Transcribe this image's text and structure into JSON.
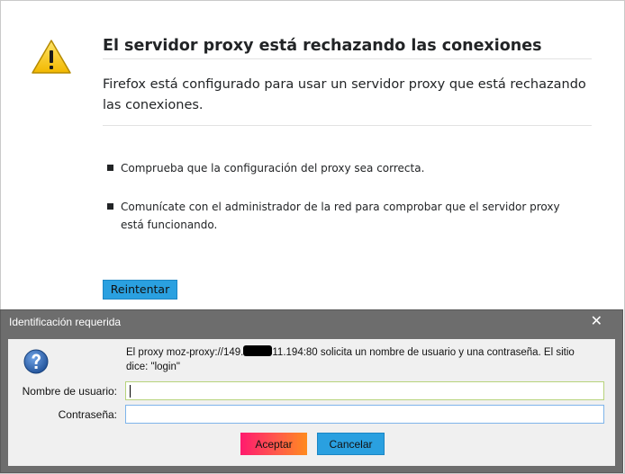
{
  "error_page": {
    "title": "El servidor proxy está rechazando las conexiones",
    "description": "Firefox está configurado para usar un servidor proxy que está rechazando las conexiones.",
    "suggestions": [
      "Comprueba que la configuración del proxy sea correcta.",
      "Comunícate con el administrador de la red para comprobar que el servidor proxy está funcionando."
    ],
    "retry_label": "Reintentar",
    "icon": "warning-icon"
  },
  "auth_dialog": {
    "title": "Identificación requerida",
    "close_glyph": "✕",
    "icon": "question-icon",
    "message_prefix": "El proxy moz-proxy://149.",
    "message_suffix": "11.194:80 solicita un nombre de usuario y una contraseña. El sitio dice: \"login\"",
    "username_label": "Nombre de usuario:",
    "username_value": "",
    "password_label": "Contraseña:",
    "password_value": "",
    "accept_label": "Aceptar",
    "cancel_label": "Cancelar"
  },
  "colors": {
    "accent_blue": "#2aa0e0",
    "warning_yellow": "#f5c400",
    "dialog_frame": "#6d6d6d",
    "question_icon_blue": "#2f64a8"
  }
}
